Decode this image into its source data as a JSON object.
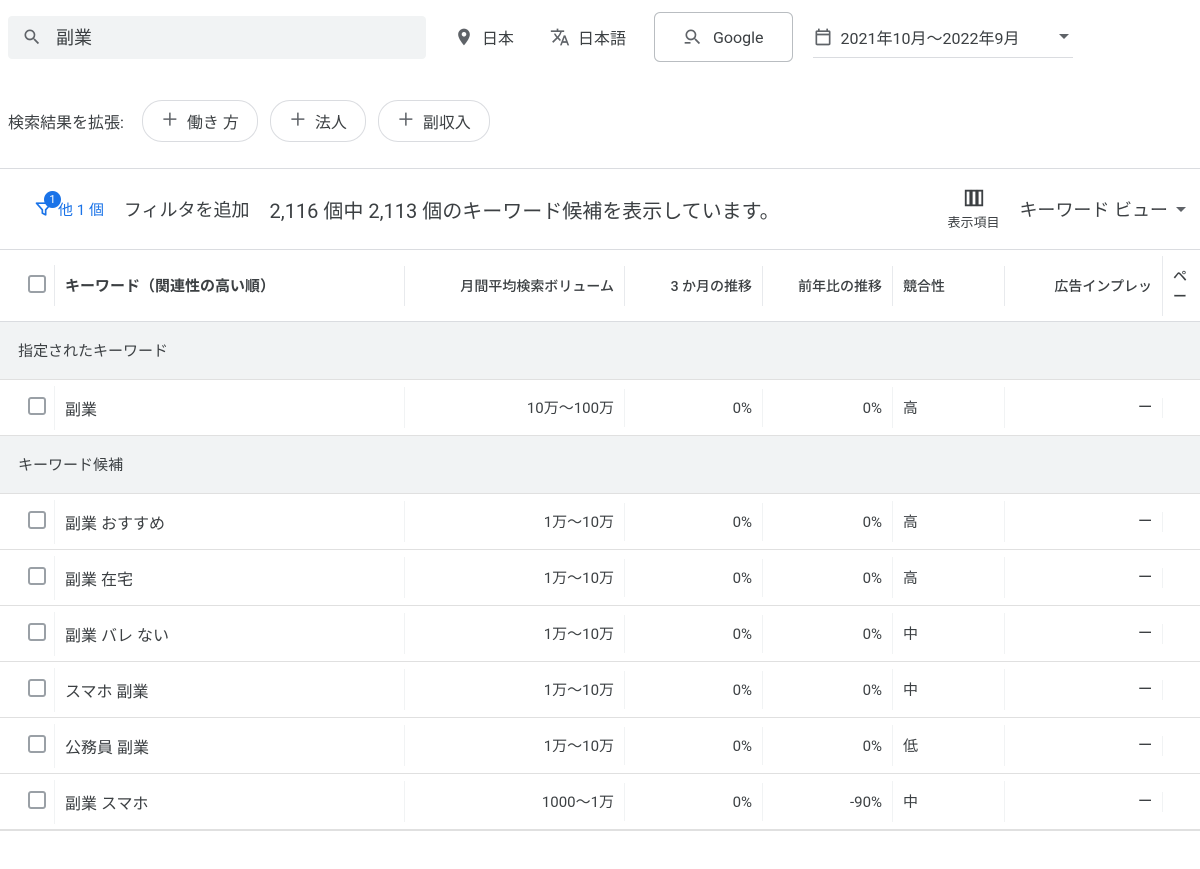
{
  "search": {
    "value": "副業"
  },
  "location": {
    "label": "日本"
  },
  "language": {
    "label": "日本語"
  },
  "network": {
    "label": "Google"
  },
  "date_range": {
    "label": "2021年10月～2022年9月"
  },
  "expand": {
    "label": "検索結果を拡張:",
    "chips": [
      "働き 方",
      "法人",
      "副収入"
    ]
  },
  "filter": {
    "badge": "1",
    "more_label": "他 1 個",
    "add_filter": "フィルタを追加",
    "summary": "2,116 個中 2,113 個のキーワード候補を表示しています。",
    "columns_label": "表示項目",
    "view_label": "キーワード ビュー"
  },
  "headers": {
    "keyword": "キーワード（関連性の高い順）",
    "volume": "月間平均検索ボリューム",
    "trend3m": "3 か月の推移",
    "yoy": "前年比の推移",
    "competition": "競合性",
    "adimp": "広告インプレッ",
    "page": "ペー"
  },
  "sections": {
    "given": "指定されたキーワード",
    "ideas": "キーワード候補"
  },
  "rows_given": [
    {
      "kw": "副業",
      "vol": "10万～100万",
      "t3": "0%",
      "yoy": "0%",
      "comp": "高",
      "imp": "—"
    }
  ],
  "rows_ideas": [
    {
      "kw": "副業 おすすめ",
      "vol": "1万～10万",
      "t3": "0%",
      "yoy": "0%",
      "comp": "高",
      "imp": "—"
    },
    {
      "kw": "副業 在宅",
      "vol": "1万～10万",
      "t3": "0%",
      "yoy": "0%",
      "comp": "高",
      "imp": "—"
    },
    {
      "kw": "副業 バレ ない",
      "vol": "1万～10万",
      "t3": "0%",
      "yoy": "0%",
      "comp": "中",
      "imp": "—"
    },
    {
      "kw": "スマホ 副業",
      "vol": "1万～10万",
      "t3": "0%",
      "yoy": "0%",
      "comp": "中",
      "imp": "—"
    },
    {
      "kw": "公務員 副業",
      "vol": "1万～10万",
      "t3": "0%",
      "yoy": "0%",
      "comp": "低",
      "imp": "—"
    },
    {
      "kw": "副業 スマホ",
      "vol": "1000～1万",
      "t3": "0%",
      "yoy": "-90%",
      "comp": "中",
      "imp": "—"
    }
  ]
}
